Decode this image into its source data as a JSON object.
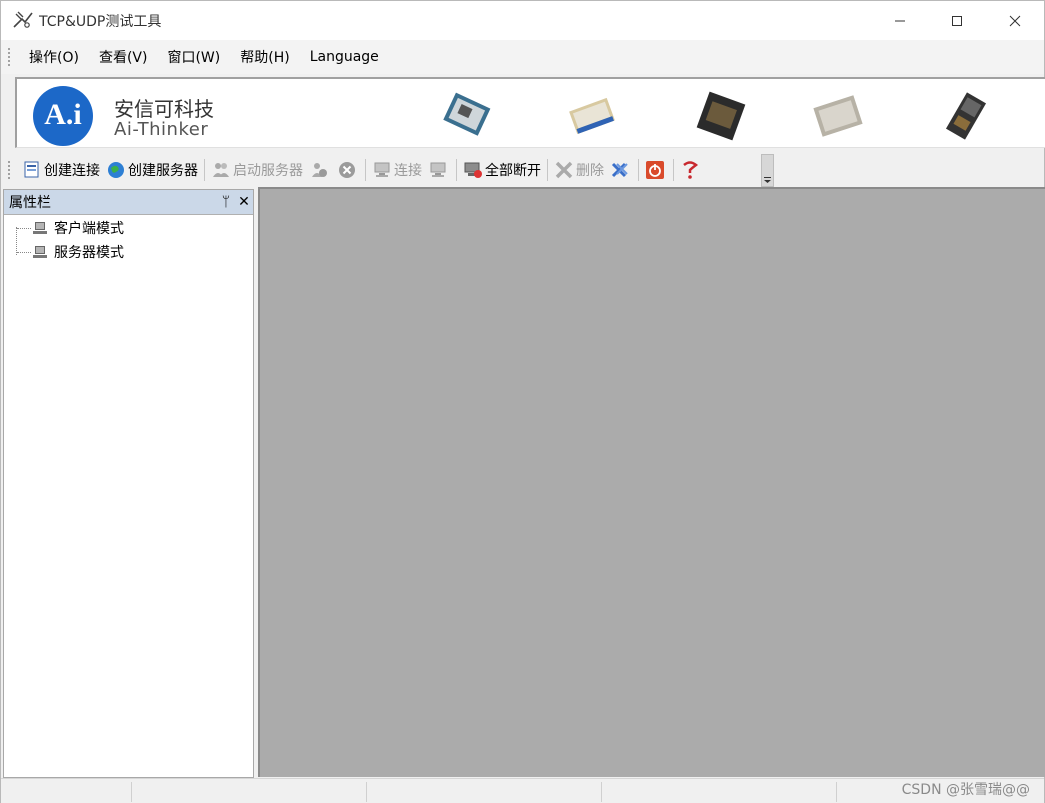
{
  "window": {
    "title": "TCP&UDP测试工具"
  },
  "menu": {
    "items": [
      "操作(O)",
      "查看(V)",
      "窗口(W)",
      "帮助(H)",
      "Language"
    ]
  },
  "banner": {
    "brand_cn": "安信可科技",
    "brand_en": "Ai-Thinker",
    "logo_text": "A.i"
  },
  "toolbar": {
    "create_connection": "创建连接",
    "create_server": "创建服务器",
    "start_server": "启动服务器",
    "connect": "连接",
    "disconnect_all": "全部断开",
    "delete": "删除"
  },
  "panel": {
    "title": "属性栏",
    "pin_glyph": "ᛘ",
    "close_glyph": "✕",
    "tree": [
      "客户端模式",
      "服务器模式"
    ]
  },
  "statusbar": {
    "watermark": "CSDN @张雪瑞@@"
  },
  "colors": {
    "mdi_background": "#ababab",
    "panel_header": "#cbd8e8",
    "logo_blue": "#1c68c8"
  }
}
